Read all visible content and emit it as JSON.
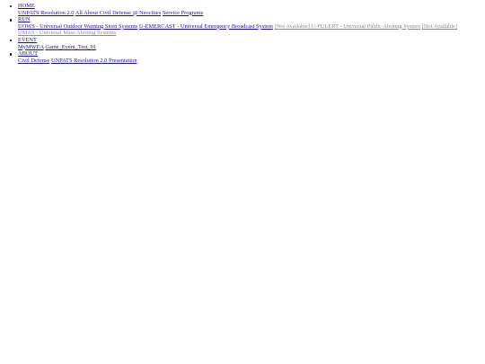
{
  "nav": {
    "sections": [
      {
        "title": "HOME",
        "links": [
          {
            "label": "UNPATS Resolution 2.0",
            "disabled": false
          },
          {
            "label": "All About Civil Defense @ Neocities",
            "disabled": false
          },
          {
            "label": "Service Programs",
            "disabled": false
          }
        ]
      },
      {
        "title": "RUN",
        "links": [
          {
            "label": "UOWS - Universal Outdoor Warning Siren Systems",
            "disabled": false
          },
          {
            "label": "U-EMERCAST - Universal Emergency Broadcast System",
            "disabled": false
          },
          {
            "label": "[Not Available] U-PULERT - Universal Public Alerting System",
            "disabled": true
          },
          {
            "label": "[Not Available] UMAS - Universal Mass Alerting Systems",
            "disabled": true
          }
        ]
      },
      {
        "title": "EVENT",
        "links": [
          {
            "label": "MyMWEA",
            "disabled": false
          },
          {
            "label": "Game_Event_Test_01",
            "disabled": false
          }
        ]
      },
      {
        "title": "ABOUT",
        "links": [
          {
            "label": "Civil Defense",
            "disabled": false
          },
          {
            "label": "UNPATS Resolution 2.0 Presentation",
            "disabled": false
          }
        ]
      }
    ]
  }
}
